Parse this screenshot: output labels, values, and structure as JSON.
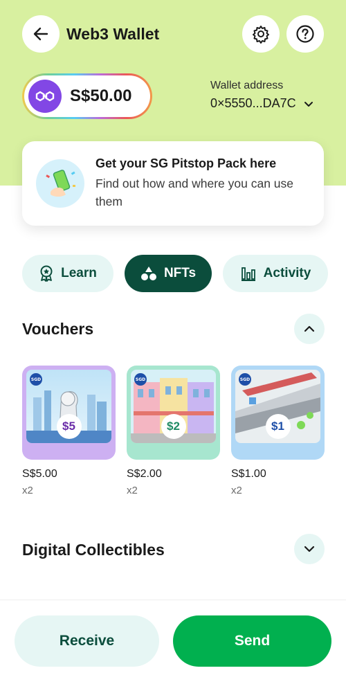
{
  "header": {
    "title": "Web3 Wallet",
    "back_icon": "arrow-left-icon",
    "settings_icon": "gear-icon",
    "help_icon": "question-icon"
  },
  "balance": {
    "amount": "S$50.00",
    "token_icon": "polygon-icon"
  },
  "wallet": {
    "label": "Wallet address",
    "address": "0×5550...DA7C"
  },
  "promo": {
    "title": "Get your SG Pitstop Pack here",
    "subtitle": "Find out how and where you can use them"
  },
  "tabs": [
    {
      "label": "Learn",
      "icon": "badge-icon",
      "active": false
    },
    {
      "label": "NFTs",
      "icon": "shapes-icon",
      "active": true
    },
    {
      "label": "Activity",
      "icon": "bar-chart-icon",
      "active": false
    }
  ],
  "vouchers_section": {
    "title": "Vouchers",
    "items": [
      {
        "badge": "$5",
        "price": "S$5.00",
        "qty": "x2",
        "theme": "#c8a6f0",
        "badge_color": "#6a2ca8"
      },
      {
        "badge": "$2",
        "price": "S$2.00",
        "qty": "x2",
        "theme": "#9fe3c8",
        "badge_color": "#1e8a63"
      },
      {
        "badge": "$1",
        "price": "S$1.00",
        "qty": "x2",
        "theme": "#a9d3f5",
        "badge_color": "#1e4fa8"
      }
    ]
  },
  "collectibles_section": {
    "title": "Digital Collectibles"
  },
  "actions": {
    "receive": "Receive",
    "send": "Send"
  },
  "colors": {
    "top_background": "#d8f0a0",
    "primary_dark": "#0b4d3c",
    "send_green": "#01b04f",
    "light_teal": "#e6f6f4"
  }
}
